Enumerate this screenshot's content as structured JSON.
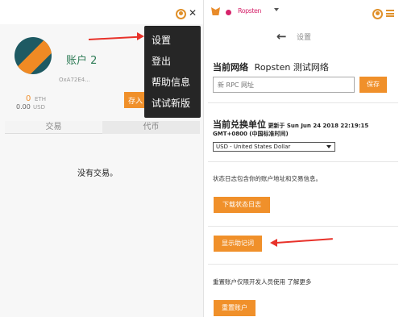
{
  "left": {
    "account_name": "账户 2",
    "account_address": "OxA72E4...",
    "balance_eth": "0",
    "balance_eth_unit": "ETH",
    "balance_usd": "0.00",
    "balance_usd_unit": "USD",
    "deposit_button": "存入",
    "tabs": [
      {
        "label": "交易"
      },
      {
        "label": "代币"
      }
    ],
    "empty_text": "没有交易。"
  },
  "menu": {
    "items": [
      {
        "label": "设置"
      },
      {
        "label": "登出"
      },
      {
        "label": "帮助信息"
      },
      {
        "label": "试试新版"
      }
    ]
  },
  "right": {
    "network_name": "Ropsten",
    "back_icon": "←",
    "page_title": "设置",
    "current_network_label": "当前网络",
    "current_network_value": "Ropsten 测试网络",
    "rpc_placeholder": "新 RPC 网址",
    "save_button": "保存",
    "currency_label": "当前兑换单位",
    "currency_updated": "更新于 Sun Jun 24 2018 22:19:15",
    "currency_timezone": "GMT+0800 (中国标准时间)",
    "currency_selected": "USD - United States Dollar",
    "log_hint": "状态日志包含你的账户地址和交易信息。",
    "download_log_button": "下载状态日志",
    "reveal_seed_button": "显示助记词",
    "reset_hint": "重置账户仅限开发人员使用 了解更多",
    "reset_button": "重置账户"
  },
  "colors": {
    "accent": "#f0902a",
    "arrow": "#e8322a",
    "network": "#d6246b",
    "menu_bg": "#262626"
  },
  "icons": [
    "account-switch-icon",
    "close-icon",
    "metamask-fox-icon",
    "network-dot-icon",
    "chevron-down-icon",
    "back-arrow-icon",
    "hamburger-menu-icon"
  ]
}
